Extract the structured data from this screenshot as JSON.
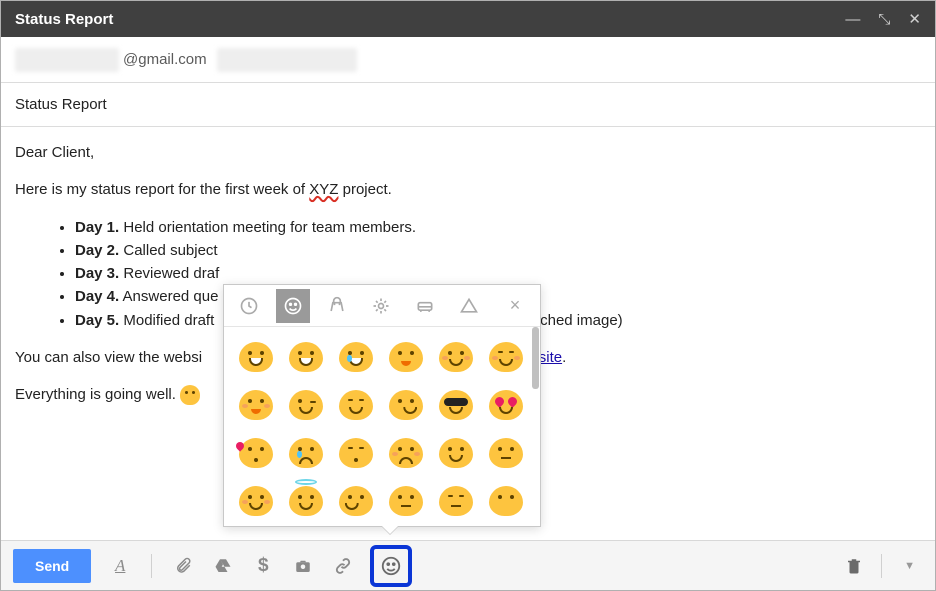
{
  "titlebar": {
    "title": "Status Report"
  },
  "recipient": {
    "email": "@gmail.com"
  },
  "subject": {
    "text": "Status Report"
  },
  "body": {
    "greeting": "Dear Client,",
    "intro_a": "Here is my status report for the first week of ",
    "intro_squig": "XYZ",
    "intro_b": " project.",
    "days": [
      {
        "label": "Day 1.",
        "text": "Held orientation meeting for team members."
      },
      {
        "label": "Day 2.",
        "text": "Called subject"
      },
      {
        "label": "Day 3.",
        "text": "Reviewed draf"
      },
      {
        "label": "Day 4.",
        "text": "Answered que"
      },
      {
        "label": "Day 5.",
        "text": "Modified draft"
      }
    ],
    "day5_partial_tail": "ttached image)",
    "link_line": "You can also view the websi",
    "link_text": "website",
    "link_tail": ".",
    "closing": "Everything is going well."
  },
  "picker": {
    "tabs": [
      "recent",
      "smileys",
      "objects",
      "nature",
      "transport",
      "symbols"
    ],
    "close": "×",
    "emojis": [
      "grin",
      "grin-teeth",
      "joy",
      "smile",
      "blush-smile",
      "closed-eyes-smile",
      "savor",
      "wink",
      "relieved",
      "sly",
      "sunglasses",
      "heart-eyes",
      "kiss-heart",
      "crying",
      "sleepy",
      "weary",
      "slight-smile",
      "neutral",
      "hug",
      "halo",
      "thinking",
      "neutral-flat",
      "expressionless",
      "no-mouth"
    ]
  },
  "toolbar": {
    "send": "Send",
    "format": "A",
    "dollar": "$"
  }
}
